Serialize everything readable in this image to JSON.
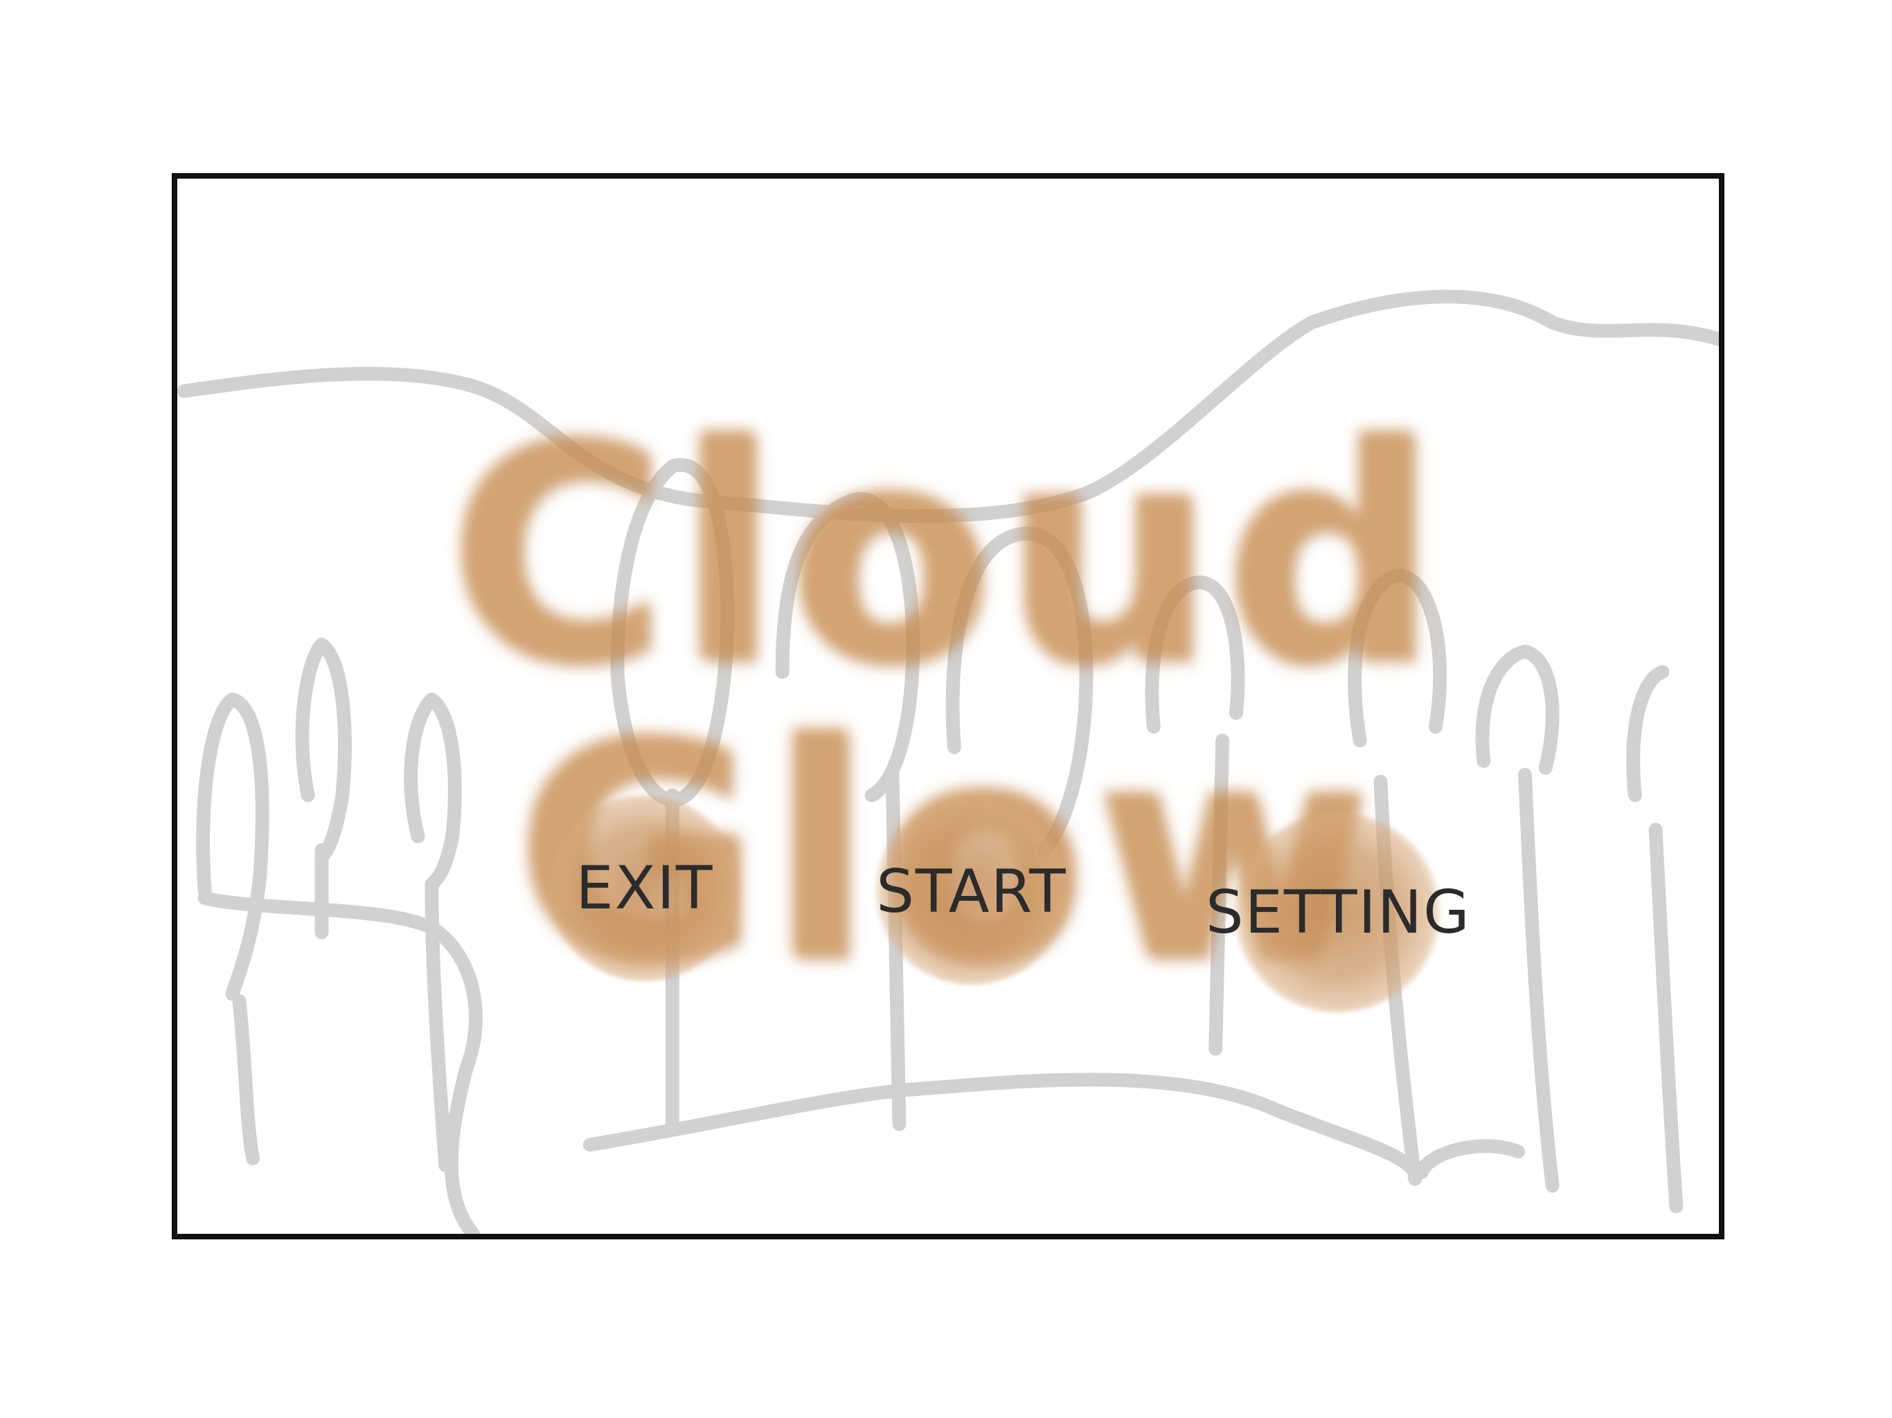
{
  "game": {
    "title": "Cloud Glow"
  },
  "menu": {
    "exit_label": "EXIT",
    "start_label": "START",
    "setting_label": "SETTING"
  },
  "colors": {
    "frame_border": "#111111",
    "title_ink": "#c68a4c",
    "button_blob": "#d2a274",
    "sketch_lines": "#c8c8c8",
    "label_ink": "#2b2b2b"
  }
}
